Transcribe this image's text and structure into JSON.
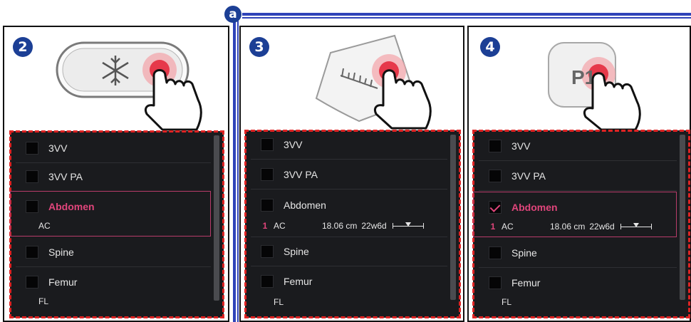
{
  "marker": {
    "label": "a"
  },
  "panels": [
    {
      "step": "2",
      "items": [
        {
          "label": "3VV"
        },
        {
          "label": "3VV PA"
        },
        {
          "label": "Abdomen",
          "sub": "AC"
        },
        {
          "label": "Spine"
        },
        {
          "label": "Femur",
          "sub": "FL"
        }
      ]
    },
    {
      "step": "3",
      "items": [
        {
          "label": "3VV"
        },
        {
          "label": "3VV PA"
        },
        {
          "label": "Abdomen",
          "sub_index": "1",
          "sub": "AC",
          "measurement": "18.06 cm",
          "ga": "22w6d"
        },
        {
          "label": "Spine"
        },
        {
          "label": "Femur",
          "sub": "FL"
        }
      ]
    },
    {
      "step": "4",
      "button_label": "P1",
      "items": [
        {
          "label": "3VV"
        },
        {
          "label": "3VV PA"
        },
        {
          "label": "Abdomen",
          "sub_index": "1",
          "sub": "AC",
          "measurement": "18.06 cm",
          "ga": "22w6d"
        },
        {
          "label": "Spine"
        },
        {
          "label": "Femur",
          "sub": "FL"
        }
      ]
    }
  ],
  "colors": {
    "accent": "#e0457b",
    "badge": "#1c3f95",
    "divider": "#2f43b8",
    "list_bg": "#1a1b1e",
    "highlight_dash": "#e02323"
  }
}
